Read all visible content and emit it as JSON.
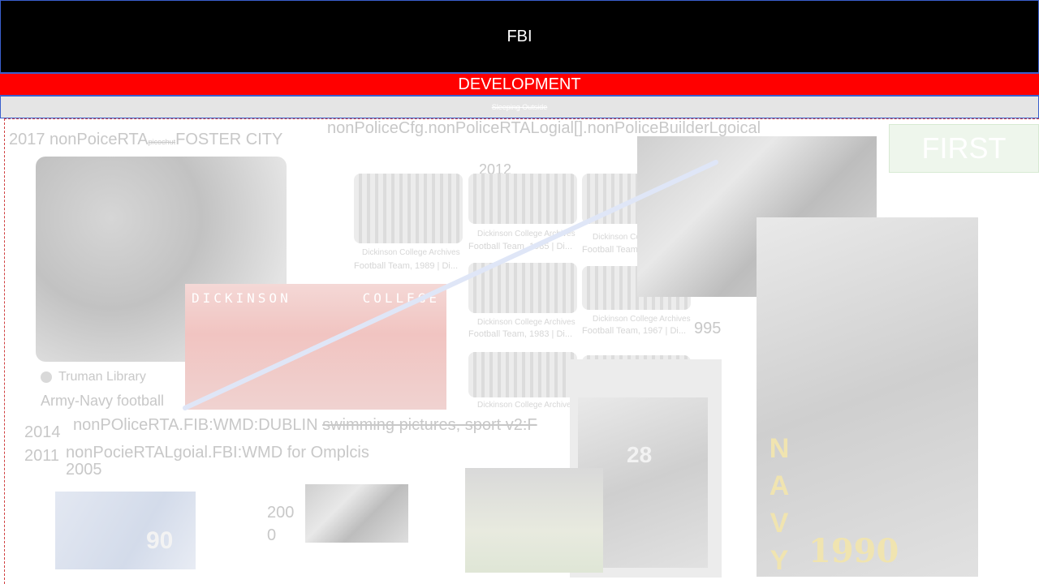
{
  "header": {
    "title": "FBI"
  },
  "banner": {
    "development": "DEVELOPMENT",
    "status": "Sleeping Outside"
  },
  "labels": {
    "top_left": "2017 nonPoiceRTA",
    "top_left_small": "picochut",
    "top_left_city": "FOSTER CITY",
    "top_center": "nonPoliceCfg.nonPoliceRTALogial[].nonPoliceBuilderLgoical",
    "year_2012": "2012",
    "year_1995": "995",
    "truman": "Truman Library",
    "army_navy": "Army-Navy football",
    "year_2014": "2014",
    "year_2011": "2011",
    "year_2005": "2005",
    "dublin_line": "nonPOliceRTA.FIB:WMD:DUBLIN ",
    "dublin_strike": "swimming pictures, sport v2:F",
    "ompl_line": "nonPocieRTALgoial.FBI:WMD for Omplcis",
    "year_2000_a": "200",
    "year_2000_b": "0",
    "first_box": "FIRST"
  },
  "photo_captions": {
    "archives": "Dickinson College Archives",
    "fb_1989": "Football Team, 1989 | Di...",
    "fb_1985": "Football Team, 1985 | Di...",
    "fb_1984": "Football Team, 1984 | Di...",
    "fb_1983": "Football Team, 1983 | Di...",
    "fb_1967": "Football Team, 1967 | Di...",
    "dickinson_left": "DICKINSON",
    "dickinson_right": "COLLEGE",
    "navy_word": "NAVY",
    "navy_year": "1990",
    "jersey_28": "28",
    "jersey_90": "90"
  },
  "colors": {
    "header_bg": "#000000",
    "development_bg": "#ff0000",
    "status_bg": "#e5e5e5",
    "accent_border": "#3a5fcd",
    "timeline_line": "#dfe6f7"
  },
  "icons": {
    "library": "eagle-seal-icon"
  }
}
